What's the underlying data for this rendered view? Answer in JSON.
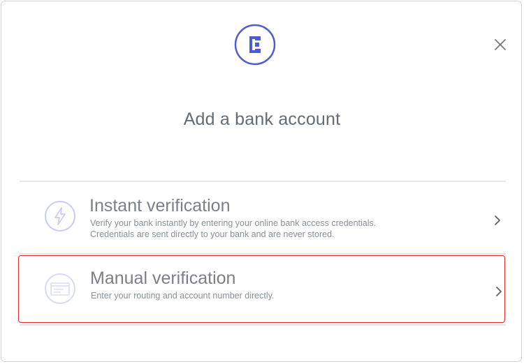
{
  "dialog": {
    "title": "Add a bank account",
    "close_label": "Close",
    "logo_letter": "E",
    "accent_color": "#4f5bd5"
  },
  "options": [
    {
      "title": "Instant verification",
      "description_line1": "Verify your bank instantly by entering your online bank access credentials.",
      "description_line2": "Credentials are sent directly to your bank and are never stored.",
      "icon": "lightning-icon"
    },
    {
      "title": "Manual verification",
      "description_line1": "Enter your routing and account number directly.",
      "icon": "check-document-icon"
    }
  ]
}
